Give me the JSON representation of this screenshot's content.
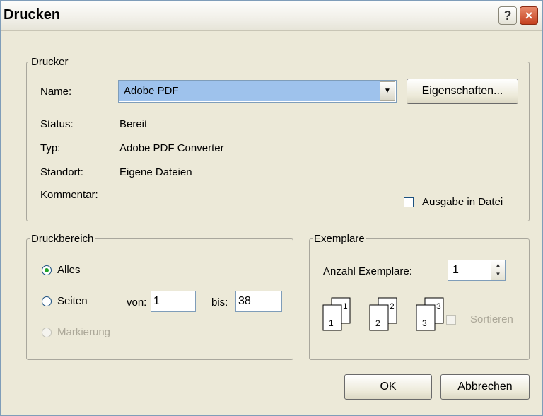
{
  "window": {
    "title": "Drucken",
    "help_label": "?",
    "close_label": "×"
  },
  "drucker": {
    "legend": "Drucker",
    "name_label": "Name:",
    "name_value": "Adobe PDF",
    "properties_button": "Eigenschaften...",
    "status_label": "Status:",
    "status_value": "Bereit",
    "typ_label": "Typ:",
    "typ_value": "Adobe PDF Converter",
    "standort_label": "Standort:",
    "standort_value": "Eigene Dateien",
    "kommentar_label": "Kommentar:",
    "print_to_file_label": "Ausgabe in Datei",
    "print_to_file_checked": false
  },
  "druckbereich": {
    "legend": "Druckbereich",
    "alles_label": "Alles",
    "seiten_label": "Seiten",
    "von_label": "von:",
    "von_value": "1",
    "bis_label": "bis:",
    "bis_value": "38",
    "markierung_label": "Markierung",
    "selected": "Alles"
  },
  "exemplare": {
    "legend": "Exemplare",
    "count_label": "Anzahl Exemplare:",
    "count_value": "1",
    "collate_label": "Sortieren",
    "collate_checked": false,
    "collate_icon": "collate-pages-icon",
    "page_numbers": [
      "1",
      "1",
      "2",
      "2",
      "3",
      "3"
    ]
  },
  "buttons": {
    "ok": "OK",
    "cancel": "Abbrechen"
  }
}
